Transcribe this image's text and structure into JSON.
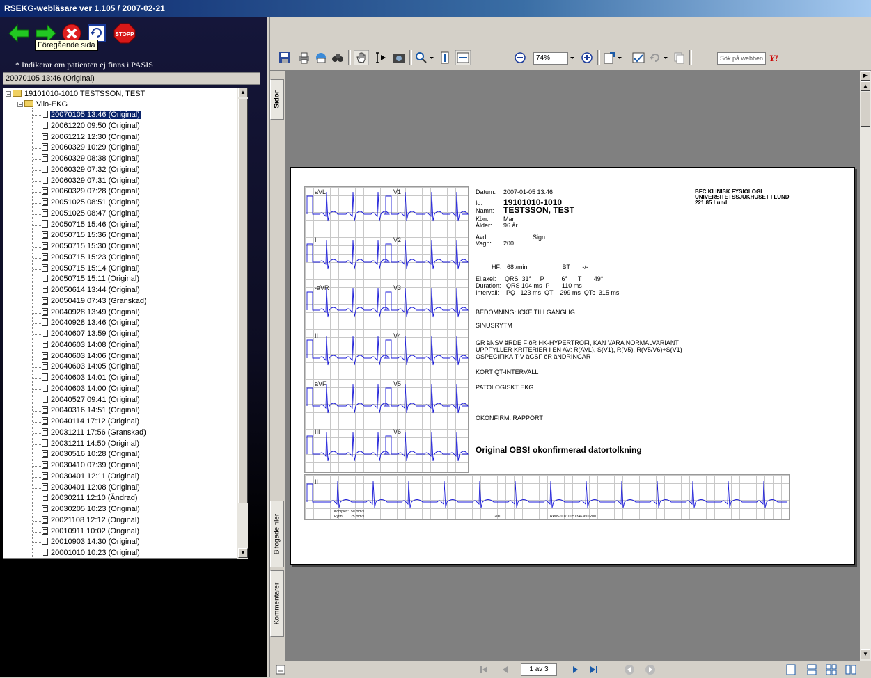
{
  "window": {
    "title": "RSEKG-webläsare ver 1.105 / 2007-02-21"
  },
  "nav": {
    "tooltip": "Föregående sida",
    "stop_label": "STOPP"
  },
  "left": {
    "indikerar": "* Indikerar om patienten ej finns i PASIS",
    "selected_display": "20070105 13:46 (Original)",
    "tree": {
      "patient": "19101010-1010 TESTSSON, TEST",
      "folder": "Vilo-EKG",
      "items": [
        "20070105 13:46 (Original)",
        "20061220 09:50 (Original)",
        "20061212 12:30 (Original)",
        "20060329 10:29 (Original)",
        "20060329 08:38 (Original)",
        "20060329 07:32 (Original)",
        "20060329 07:31 (Original)",
        "20060329 07:28 (Original)",
        "20051025 08:51 (Original)",
        "20051025 08:47 (Original)",
        "20050715 15:46 (Original)",
        "20050715 15:36 (Original)",
        "20050715 15:30 (Original)",
        "20050715 15:23 (Original)",
        "20050715 15:14 (Original)",
        "20050715 15:11 (Original)",
        "20050614 13:44 (Original)",
        "20050419 07:43 (Granskad)",
        "20040928 13:49 (Original)",
        "20040928 13:46 (Original)",
        "20040607 13:59 (Original)",
        "20040603 14:08 (Original)",
        "20040603 14:06 (Original)",
        "20040603 14:05 (Original)",
        "20040603 14:01 (Original)",
        "20040603 14:00 (Original)",
        "20040527 09:41 (Original)",
        "20040316 14:51 (Original)",
        "20040114 17:12 (Original)",
        "20031211 17:56 (Granskad)",
        "20031211 14:50 (Original)",
        "20030516 10:28 (Original)",
        "20030410 07:39 (Original)",
        "20030401 12:11 (Original)",
        "20030401 12:08 (Original)",
        "20030211 12:10 (Ändrad)",
        "20030205 10:23 (Original)",
        "20021108 12:12 (Original)",
        "20010911 10:02 (Original)",
        "20010903 14:30 (Original)",
        "20001010 10:23 (Original)"
      ]
    }
  },
  "toolbar": {
    "zoom": "74%",
    "search_placeholder": "Sök på webben"
  },
  "side_tabs": {
    "pages": "Sidor",
    "attachments": "Bifogade filer",
    "comments": "Kommentarer"
  },
  "pager": {
    "page": "1 av 3"
  },
  "ecg": {
    "leads": [
      "aVL",
      "V1",
      "I",
      "V2",
      "-aVR",
      "V3",
      "II",
      "V4",
      "aVF",
      "V5",
      "III",
      "V6"
    ],
    "rhythm_lead": "II",
    "footer": {
      "komplex_lbl": "Komplex:",
      "komplex_val": "50 mm/s",
      "rytm_lbl": "Rytm:",
      "rytm_val": "25 mm/s",
      "code1": "200",
      "code2": "RR052007010513463601200"
    },
    "datum_lbl": "Datum:",
    "datum": "2007-01-05 13:46",
    "id_lbl": "Id:",
    "id": "19101010-1010",
    "namn_lbl": "Namn:",
    "namn": "TESTSSON, TEST",
    "kon_lbl": "Kön:",
    "kon": "Man",
    "alder_lbl": "Ålder:",
    "alder": "96 år",
    "avd_lbl": "Avd:",
    "sign_lbl": "Sign:",
    "vagn_lbl": "Vagn:",
    "vagn": "200",
    "clinic": [
      "BFC KLINISK FYSIOLOGI",
      "UNIVERSITETSSJUKHUSET I LUND",
      "221 85 Lund"
    ],
    "hf_line": "HF:   68 /min                    BT       -/-",
    "elaxel_line": "El.axel:     QRS  31°     P          6°      T       49°",
    "duration_line": "Duration:   QRS 104 ms  P       110 ms",
    "intervall_line": "Intervall:    PQ   123 ms  QT    299 ms  QTc  315 ms",
    "bedomning": "BEDÖMNING: ICKE TILLGÄNGLIG.",
    "sinus": "SINUSRYTM",
    "findings": [
      "GR äNSV äRDE F öR HK-HYPERTROFI, KAN VARA NORMALVARIANT",
      "UPPFYLLER KRITERIER I EN AV: R(AVL), S(V1), R(V5), R(V5/V6)+S(V1)",
      "OSPECIFIKA T-V äGSF öR äNDRINGAR"
    ],
    "kort_qt": "KORT QT-INTERVALL",
    "patologiskt": "PATOLOGISKT EKG",
    "okonfirm": "OKONFIRM. RAPPORT",
    "original_obs": "Original OBS! okonfirmerad datortolkning"
  }
}
